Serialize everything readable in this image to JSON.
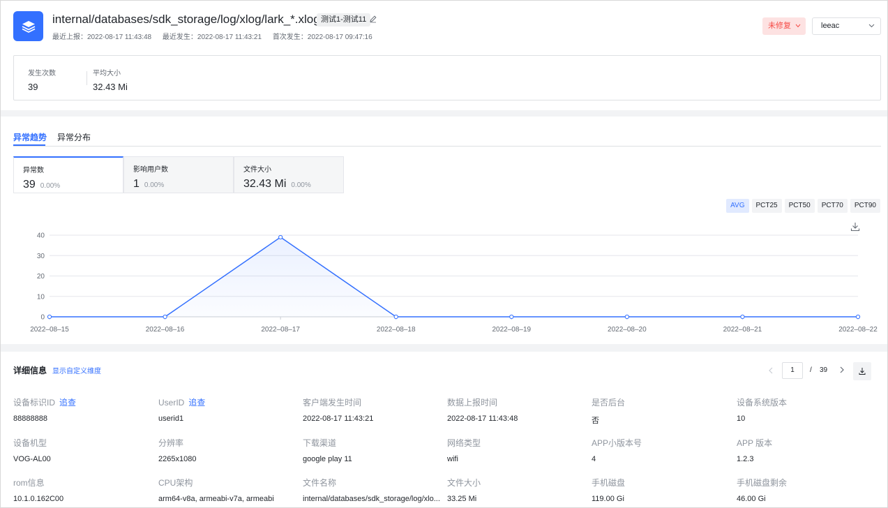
{
  "header": {
    "title": "internal/databases/sdk_storage/log/xlog/lark_*.xlog",
    "tag": "测试1-测试11",
    "meta": [
      "最近上报：2022-08-17 11:43:48",
      "最近发生：2022-08-17 11:43:21",
      "首次发生：2022-08-17 09:47:16"
    ],
    "status": "未修复",
    "assignee": "leeac",
    "accent": "#3370ff",
    "status_color": "#f54a45"
  },
  "summary": [
    {
      "label": "发生次数",
      "value": "39"
    },
    {
      "label": "平均大小",
      "value": "32.43 Mi"
    }
  ],
  "trend": {
    "tabs": [
      {
        "label": "异常趋势"
      },
      {
        "label": "异常分布"
      }
    ],
    "metrics": [
      {
        "label": "异常数",
        "value": "39",
        "change": "0.00%"
      },
      {
        "label": "影响用户数",
        "value": "1",
        "change": "0.00%"
      },
      {
        "label": "文件大小",
        "value": "32.43 Mi",
        "change": "0.00%"
      }
    ],
    "percentiles": [
      "AVG",
      "PCT25",
      "PCT50",
      "PCT70",
      "PCT90"
    ]
  },
  "chart_data": {
    "type": "area",
    "x": [
      "2022–08–15",
      "2022–08–16",
      "2022–08–17",
      "2022–08–18",
      "2022–08–19",
      "2022–08–20",
      "2022–08–21",
      "2022–08–22"
    ],
    "series": [
      {
        "values": [
          0,
          0,
          39,
          0,
          0,
          0,
          0,
          0
        ]
      }
    ],
    "yticks": [
      0,
      10,
      20,
      30,
      40
    ],
    "ylim": [
      0,
      40
    ],
    "grid": true,
    "color": "#3370ff"
  },
  "detail": {
    "title": "详细信息",
    "custom_link": "显示自定义维度",
    "pager": {
      "current": "1",
      "sep": "/",
      "total": "39"
    },
    "trace_label": "追查",
    "fields": [
      {
        "label": "设备标识ID",
        "value": "88888888",
        "trace": true
      },
      {
        "label": "UserID",
        "value": "userid1",
        "trace": true
      },
      {
        "label": "客户端发生时间",
        "value": "2022-08-17 11:43:21"
      },
      {
        "label": "数据上报时间",
        "value": "2022-08-17 11:43:48"
      },
      {
        "label": "是否后台",
        "value": "否"
      },
      {
        "label": "设备系统版本",
        "value": "10"
      },
      {
        "label": "设备机型",
        "value": "VOG-AL00"
      },
      {
        "label": "分辨率",
        "value": "2265x1080"
      },
      {
        "label": "下载渠道",
        "value": "google play 11"
      },
      {
        "label": "网络类型",
        "value": "wifi"
      },
      {
        "label": "APP小版本号",
        "value": "4"
      },
      {
        "label": "APP 版本",
        "value": "1.2.3"
      },
      {
        "label": "rom信息",
        "value": "10.1.0.162C00"
      },
      {
        "label": "CPU架构",
        "value": "arm64-v8a, armeabi-v7a, armeabi"
      },
      {
        "label": "文件名称",
        "value": "internal/databases/sdk_storage/log/xlo..."
      },
      {
        "label": "文件大小",
        "value": "33.25 Mi"
      },
      {
        "label": "手机磁盘",
        "value": "119.00 Gi"
      },
      {
        "label": "手机磁盘剩余",
        "value": "46.00 Gi"
      }
    ]
  }
}
